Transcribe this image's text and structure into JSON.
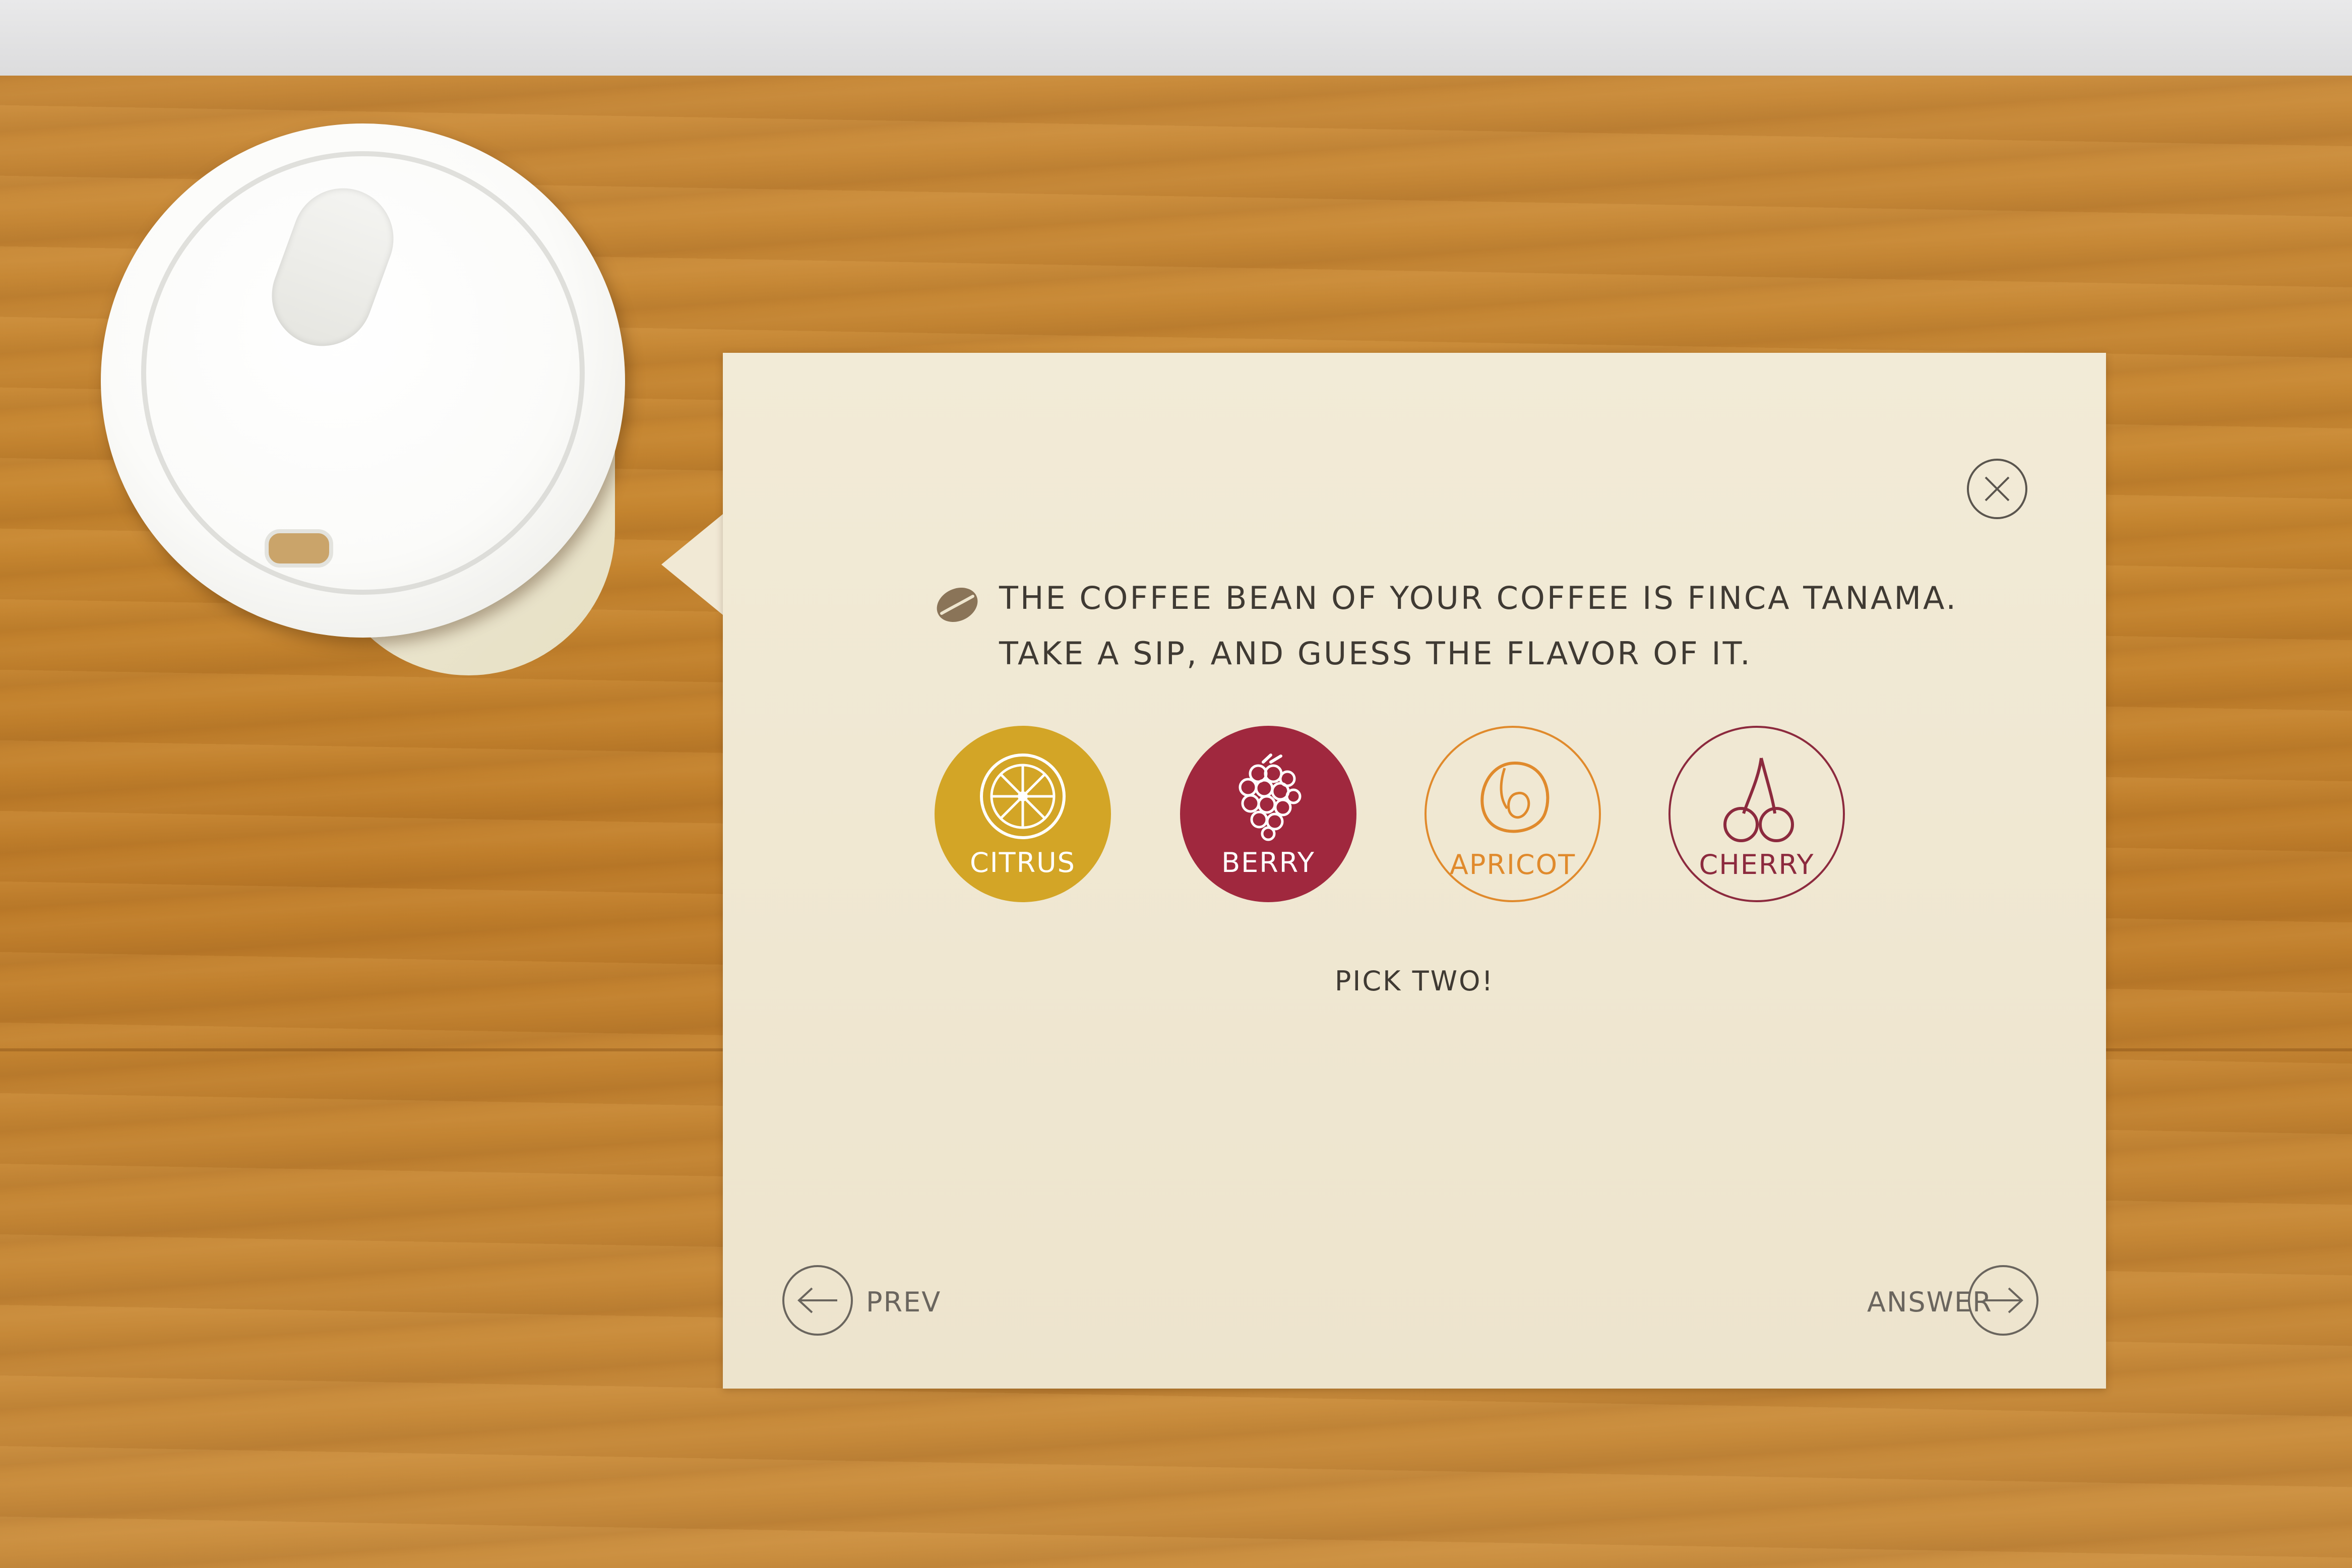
{
  "card": {
    "question_line1": "The coffee bean of your coffee is Finca Tanama.",
    "question_line2": "Take a sip, and guess the flavor of it.",
    "hint": "Pick two!",
    "options": [
      {
        "label": "Citrus",
        "icon": "citrus-icon",
        "color": "#d3a526",
        "selected": true
      },
      {
        "label": "Berry",
        "icon": "berry-icon",
        "color": "#a0283e",
        "selected": true
      },
      {
        "label": "Apricot",
        "icon": "apricot-icon",
        "color": "#e08a2c",
        "selected": false
      },
      {
        "label": "Cherry",
        "icon": "cherry-icon",
        "color": "#8c2a3e",
        "selected": false
      }
    ],
    "nav": {
      "prev_label": "Prev",
      "answer_label": "Answer"
    }
  },
  "colors": {
    "card_background": "#f2ebd7",
    "text": "#3f3a33",
    "table_wood": "#c5852f"
  }
}
